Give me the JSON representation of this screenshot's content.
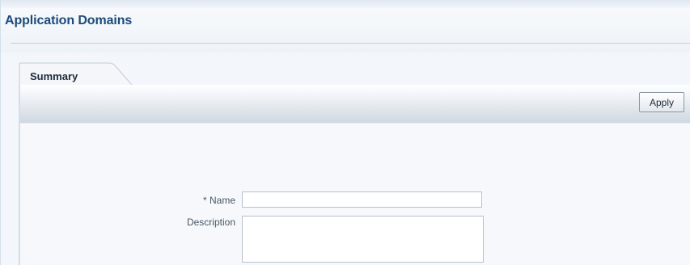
{
  "page": {
    "title": "Application Domains"
  },
  "tabs": [
    {
      "label": "Summary",
      "selected": true
    }
  ],
  "toolbar": {
    "apply_label": "Apply"
  },
  "form": {
    "name": {
      "required_marker": "*",
      "label": "Name",
      "value": ""
    },
    "description": {
      "label": "Description",
      "value": ""
    }
  },
  "colors": {
    "title": "#1c4a7a",
    "background": "#f3f6fa",
    "input_border": "#b7c2cd"
  }
}
